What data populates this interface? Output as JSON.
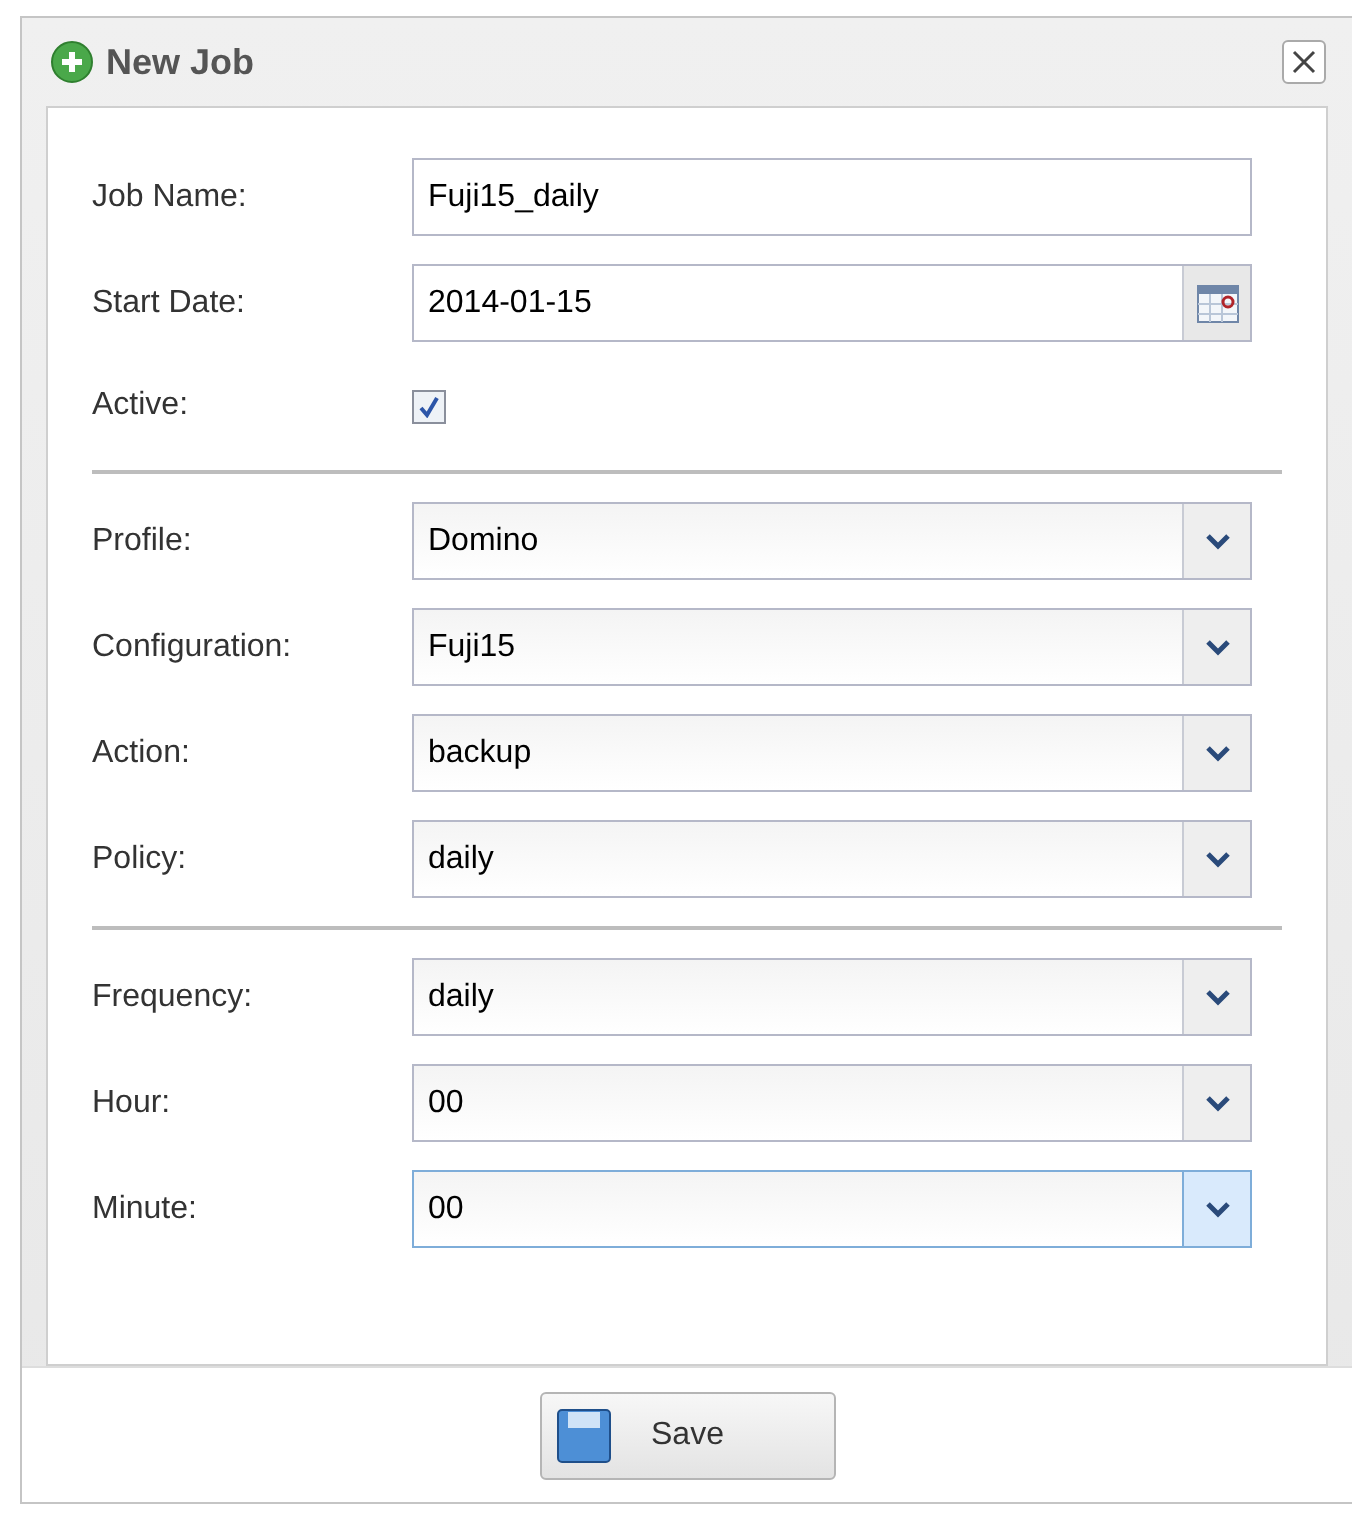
{
  "window": {
    "title": "New Job"
  },
  "sections": [
    {
      "fields": [
        {
          "kind": "text",
          "label": "Job Name:",
          "value": "Fuji15_daily"
        },
        {
          "kind": "date",
          "label": "Start Date:",
          "value": "2014-01-15"
        },
        {
          "kind": "checkbox",
          "label": "Active:",
          "checked": true
        }
      ]
    },
    {
      "fields": [
        {
          "kind": "select",
          "label": "Profile:",
          "value": "Domino",
          "focused": false
        },
        {
          "kind": "select",
          "label": "Configuration:",
          "value": "Fuji15",
          "focused": false
        },
        {
          "kind": "select",
          "label": "Action:",
          "value": "backup",
          "focused": false
        },
        {
          "kind": "select",
          "label": "Policy:",
          "value": "daily",
          "focused": false
        }
      ]
    },
    {
      "fields": [
        {
          "kind": "select",
          "label": "Frequency:",
          "value": "daily",
          "focused": false
        },
        {
          "kind": "select",
          "label": "Hour:",
          "value": "00",
          "focused": false
        },
        {
          "kind": "select",
          "label": "Minute:",
          "value": "00",
          "focused": true
        }
      ]
    }
  ],
  "save_button": {
    "label": "Save"
  }
}
